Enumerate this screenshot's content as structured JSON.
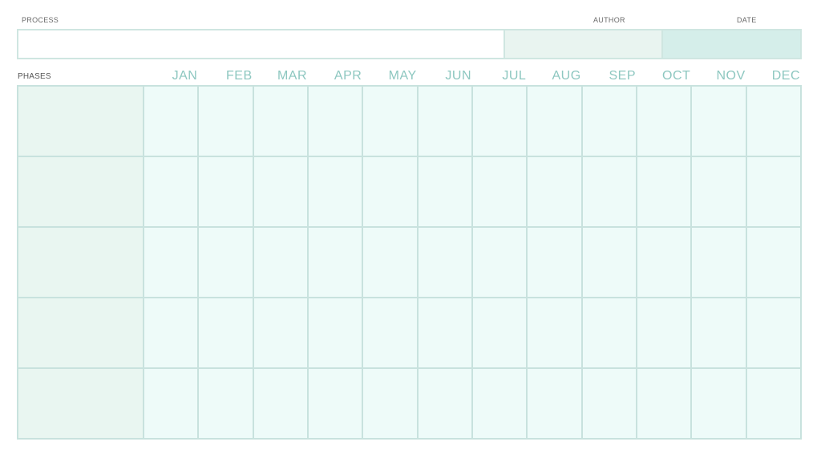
{
  "header": {
    "process_label": "PROCESS",
    "author_label": "AUTHOR",
    "date_label": "DATE",
    "process_value": "",
    "author_value": "",
    "date_value": ""
  },
  "grid": {
    "phases_label": "PHASES",
    "months": [
      "JAN",
      "FEB",
      "MAR",
      "APR",
      "MAY",
      "JUN",
      "JUL",
      "AUG",
      "SEP",
      "OCT",
      "NOV",
      "DEC"
    ],
    "phase_rows": 5
  },
  "colors": {
    "accent": "#8dc7c0",
    "border": "#c8e2de",
    "cell": "#eefbf9",
    "phase_cell": "#e9f6f1",
    "author_fill": "#e9f4f0",
    "date_fill": "#d5eeea"
  }
}
